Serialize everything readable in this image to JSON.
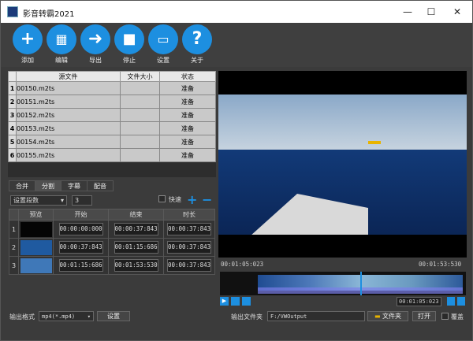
{
  "window": {
    "title": "影音转霸2021",
    "minimize": "—",
    "maximize": "☐",
    "close": "✕"
  },
  "toolbar": {
    "add": "添加",
    "edit": "编辑",
    "export": "导出",
    "stop": "停止",
    "settings": "设置",
    "about": "关于"
  },
  "files": {
    "headers": [
      "源文件",
      "文件大小",
      "状态"
    ],
    "rows": [
      {
        "n": "1",
        "name": "00150.m2ts",
        "size": "",
        "status": "准备"
      },
      {
        "n": "2",
        "name": "00151.m2ts",
        "size": "",
        "status": "准备"
      },
      {
        "n": "3",
        "name": "00152.m2ts",
        "size": "",
        "status": "准备"
      },
      {
        "n": "4",
        "name": "00153.m2ts",
        "size": "",
        "status": "准备"
      },
      {
        "n": "5",
        "name": "00154.m2ts",
        "size": "",
        "status": "准备"
      },
      {
        "n": "6",
        "name": "00155.m2ts",
        "size": "",
        "status": "准备"
      }
    ]
  },
  "tabs": [
    "合并",
    "分割",
    "字幕",
    "配音"
  ],
  "segments": {
    "mode": "设置段数",
    "count": "3",
    "fast": "快速",
    "headers": [
      "预览",
      "开始",
      "结束",
      "时长"
    ],
    "rows": [
      {
        "n": "1",
        "start": "00:00:00:000",
        "end": "00:00:37:843",
        "dur": "00:00:37:843"
      },
      {
        "n": "2",
        "start": "00:00:37:843",
        "end": "00:01:15:686",
        "dur": "00:00:37:843"
      },
      {
        "n": "3",
        "start": "00:01:15:686",
        "end": "00:01:53:530",
        "dur": "00:00:37:843"
      }
    ]
  },
  "player": {
    "current": "00:01:05:023",
    "total": "00:01:53:530",
    "marker": "00:01:05:023",
    "accent": "#1d8fe0"
  },
  "bottom": {
    "format_label": "输出格式",
    "format_value": "mp4(*.mp4)",
    "settings": "设置",
    "out_label": "输出文件夹",
    "out_path": "F:/VWOutput",
    "folder": "文件夹",
    "open": "打开",
    "overwrite": "覆盖"
  }
}
